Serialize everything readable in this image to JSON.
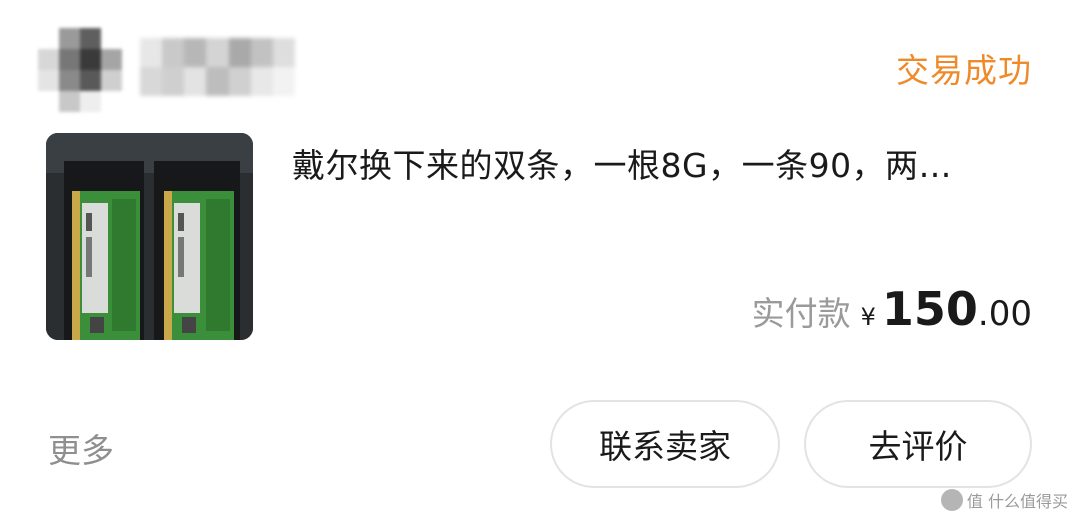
{
  "order": {
    "status": "交易成功",
    "title": "戴尔换下来的双条，一根8G，一条90，两…",
    "price_label": "实付款",
    "currency_symbol": "¥",
    "price_integer": "150",
    "price_decimal": ".00"
  },
  "footer": {
    "more_label": "更多",
    "contact_seller_label": "联系卖家",
    "review_label": "去评价"
  },
  "watermark": {
    "text": "值 什么值得买"
  },
  "colors": {
    "status": "#ef8a2b",
    "pcb_green": "#3b8f3a"
  }
}
